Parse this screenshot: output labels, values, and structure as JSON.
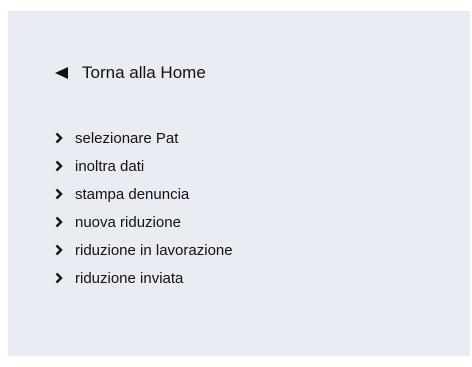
{
  "sidebar": {
    "back_icon": "left-triangle-icon",
    "home_label": "Torna alla Home",
    "item_icon": "chevron-right-icon",
    "items": [
      {
        "label": "selezionare Pat"
      },
      {
        "label": "inoltra dati"
      },
      {
        "label": "stampa denuncia"
      },
      {
        "label": "nuova riduzione"
      },
      {
        "label": "riduzione in lavorazione"
      },
      {
        "label": "riduzione inviata"
      }
    ]
  },
  "colors": {
    "panel_background": "#e9ecf2",
    "text": "#111111"
  }
}
